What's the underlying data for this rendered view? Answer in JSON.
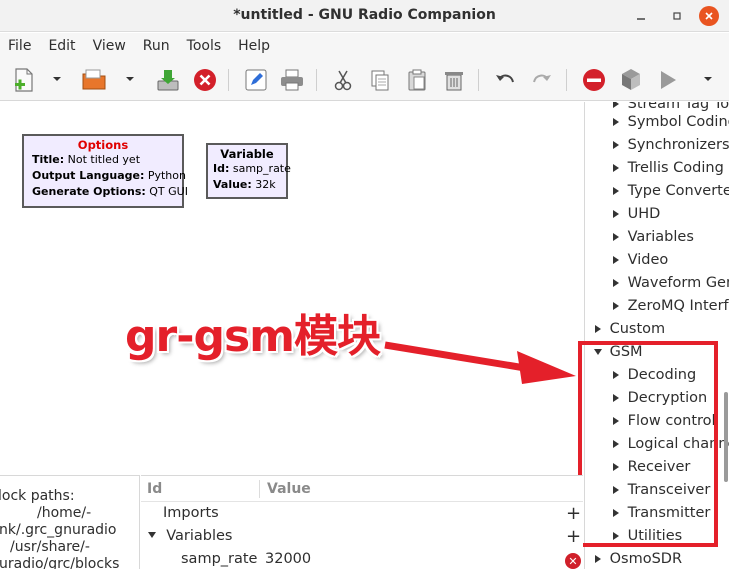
{
  "window": {
    "title": "*untitled - GNU Radio Companion"
  },
  "menu": [
    "File",
    "Edit",
    "View",
    "Run",
    "Tools",
    "Help"
  ],
  "toolbar": {
    "icons": [
      "new-file-icon",
      "open-folder-icon",
      "save-icon",
      "close-icon",
      "edit-icon",
      "print-icon",
      "cut-icon",
      "copy-icon",
      "paste-icon",
      "delete-icon",
      "undo-icon",
      "redo-icon",
      "stop-icon",
      "generate-icon",
      "run-icon"
    ]
  },
  "canvas": {
    "options_block": {
      "title": "Options",
      "rows": [
        {
          "key": "Title:",
          "value": " Not titled yet"
        },
        {
          "key": "Output Language:",
          "value": " Python"
        },
        {
          "key": "Generate Options:",
          "value": " QT GUI"
        }
      ]
    },
    "variable_block": {
      "title": "Variable",
      "rows": [
        {
          "key": "Id:",
          "value": " samp_rate"
        },
        {
          "key": "Value:",
          "value": " 32k"
        }
      ]
    }
  },
  "annotation": {
    "text": "gr-gsm模块",
    "color": "#e4202a"
  },
  "tree": {
    "top_partial": "Stream Tag Too",
    "children_before": [
      "Symbol Coding",
      "Synchronizers",
      "Trellis Coding",
      "Type Converters",
      "UHD",
      "Variables",
      "Video",
      "Waveform Gene",
      "ZeroMQ Interfa"
    ],
    "custom": "Custom",
    "gsm": "GSM",
    "gsm_children": [
      "Decoding",
      "Decryption",
      "Flow control",
      "Logical channels",
      "Receiver",
      "Transceiver",
      "Transmitter",
      "Utilities"
    ],
    "osmosdr": "OsmoSDR"
  },
  "console": {
    "lines": [
      "lock paths:",
      "/home/-",
      "nk/.grc_gnuradio",
      "/usr/share/-",
      "uradio/grc/blocks"
    ]
  },
  "variables_panel": {
    "col_id": "Id",
    "col_value": "Value",
    "imports": "Imports",
    "variables": "Variables",
    "rows": [
      {
        "id": "samp_rate",
        "value": "32000"
      }
    ]
  },
  "colors": {
    "accent": "#e95420",
    "highlight": "#e4202a",
    "block_fill": "#f1ecff"
  }
}
